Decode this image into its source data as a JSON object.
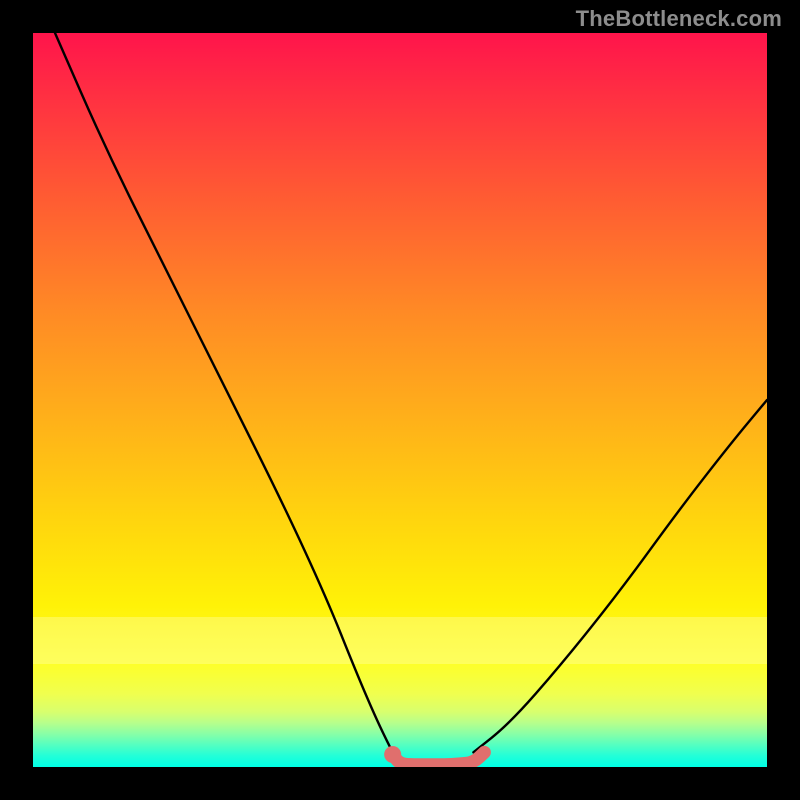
{
  "attribution": "TheBottleneck.com",
  "colors": {
    "background": "#000000",
    "gradient_top": "#ff144b",
    "gradient_mid": "#ffd40e",
    "gradient_bottom": "#00ffe6",
    "curve": "#000000",
    "marker": "#e06f6d"
  },
  "chart_data": {
    "type": "line",
    "title": "",
    "xlabel": "",
    "ylabel": "",
    "xlim": [
      0,
      100
    ],
    "ylim": [
      0,
      100
    ],
    "series": [
      {
        "name": "left-curve",
        "x": [
          3,
          10,
          18,
          26,
          34,
          40,
          44,
          47,
          49.5
        ],
        "values": [
          100,
          84,
          68,
          52,
          36,
          23,
          13,
          6,
          1
        ]
      },
      {
        "name": "right-curve",
        "x": [
          60,
          65,
          72,
          80,
          88,
          95,
          100
        ],
        "values": [
          2,
          6,
          14,
          24,
          35,
          44,
          50
        ]
      },
      {
        "name": "marker-band",
        "x": [
          49,
          50,
          52,
          54,
          56,
          58,
          60,
          61.5
        ],
        "values": [
          1.7,
          0.4,
          0.3,
          0.3,
          0.3,
          0.4,
          0.6,
          2.0
        ]
      }
    ],
    "annotations": []
  }
}
